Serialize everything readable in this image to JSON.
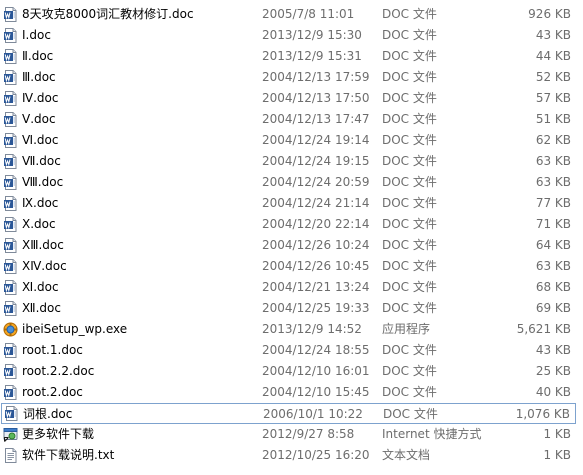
{
  "colors": {
    "secondary_text": "#6d6d6d",
    "selection_border": "#7da2ce",
    "doc_icon_blue": "#2b5797"
  },
  "files": [
    {
      "name": "8天攻克8000词汇教材修订.doc",
      "date": "2005/7/8 11:01",
      "type": "DOC 文件",
      "size": "926 KB",
      "icon": "word-doc-icon"
    },
    {
      "name": "Ⅰ.doc",
      "date": "2013/12/9 15:30",
      "type": "DOC 文件",
      "size": "43 KB",
      "icon": "word-doc-icon"
    },
    {
      "name": "Ⅱ.doc",
      "date": "2013/12/9 15:31",
      "type": "DOC 文件",
      "size": "44 KB",
      "icon": "word-doc-icon"
    },
    {
      "name": "Ⅲ.doc",
      "date": "2004/12/13 17:59",
      "type": "DOC 文件",
      "size": "52 KB",
      "icon": "word-doc-icon"
    },
    {
      "name": "Ⅳ.doc",
      "date": "2004/12/13 17:50",
      "type": "DOC 文件",
      "size": "57 KB",
      "icon": "word-doc-icon"
    },
    {
      "name": "Ⅴ.doc",
      "date": "2004/12/13 17:47",
      "type": "DOC 文件",
      "size": "51 KB",
      "icon": "word-doc-icon"
    },
    {
      "name": "Ⅵ.doc",
      "date": "2004/12/24 19:14",
      "type": "DOC 文件",
      "size": "62 KB",
      "icon": "word-doc-icon"
    },
    {
      "name": "Ⅶ.doc",
      "date": "2004/12/24 19:15",
      "type": "DOC 文件",
      "size": "63 KB",
      "icon": "word-doc-icon"
    },
    {
      "name": "Ⅷ.doc",
      "date": "2004/12/24 20:59",
      "type": "DOC 文件",
      "size": "63 KB",
      "icon": "word-doc-icon"
    },
    {
      "name": "Ⅸ.doc",
      "date": "2004/12/24 21:14",
      "type": "DOC 文件",
      "size": "77 KB",
      "icon": "word-doc-icon"
    },
    {
      "name": "Ⅹ.doc",
      "date": "2004/12/20 22:14",
      "type": "DOC 文件",
      "size": "71 KB",
      "icon": "word-doc-icon"
    },
    {
      "name": "ⅩⅢ.doc",
      "date": "2004/12/26 10:24",
      "type": "DOC 文件",
      "size": "64 KB",
      "icon": "word-doc-icon"
    },
    {
      "name": "ⅩⅣ.doc",
      "date": "2004/12/26 10:45",
      "type": "DOC 文件",
      "size": "63 KB",
      "icon": "word-doc-icon"
    },
    {
      "name": "Ⅺ.doc",
      "date": "2004/12/21 13:24",
      "type": "DOC 文件",
      "size": "68 KB",
      "icon": "word-doc-icon"
    },
    {
      "name": "Ⅻ.doc",
      "date": "2004/12/25 19:33",
      "type": "DOC 文件",
      "size": "69 KB",
      "icon": "word-doc-icon"
    },
    {
      "name": "ibeiSetup_wp.exe",
      "date": "2013/12/9 14:52",
      "type": "应用程序",
      "size": "5,621 KB",
      "icon": "setup-exe-icon"
    },
    {
      "name": "root.1.doc",
      "date": "2004/12/24 18:55",
      "type": "DOC 文件",
      "size": "43 KB",
      "icon": "word-doc-icon"
    },
    {
      "name": "root.2.2.doc",
      "date": "2004/12/10 16:01",
      "type": "DOC 文件",
      "size": "25 KB",
      "icon": "word-doc-icon"
    },
    {
      "name": "root.2.doc",
      "date": "2004/12/10 15:45",
      "type": "DOC 文件",
      "size": "40 KB",
      "icon": "word-doc-icon"
    },
    {
      "name": "词根.doc",
      "date": "2006/10/1 10:22",
      "type": "DOC 文件",
      "size": "1,076 KB",
      "icon": "word-doc-icon",
      "selected": true
    },
    {
      "name": "更多软件下载",
      "date": "2012/9/27 8:58",
      "type": "Internet 快捷方式",
      "size": "1 KB",
      "icon": "internet-shortcut-icon"
    },
    {
      "name": "软件下载说明.txt",
      "date": "2012/10/25 16:20",
      "type": "文本文档",
      "size": "1 KB",
      "icon": "text-file-icon"
    }
  ]
}
